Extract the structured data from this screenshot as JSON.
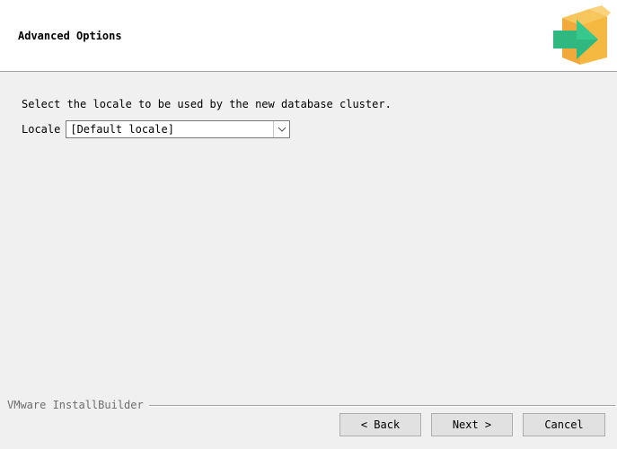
{
  "header": {
    "title": "Advanced Options",
    "logo_icon": "installer-box-arrow-icon"
  },
  "main": {
    "instruction": "Select the locale to be used by the new database cluster.",
    "locale": {
      "label": "Locale",
      "value": "[Default locale]"
    }
  },
  "footer": {
    "brand": "VMware InstallBuilder",
    "buttons": {
      "back": "< Back",
      "next": "Next >",
      "cancel": "Cancel"
    }
  },
  "colors": {
    "background": "#f0f0f0",
    "box_orange": "#f5b942",
    "arrow_green": "#2fb981"
  }
}
